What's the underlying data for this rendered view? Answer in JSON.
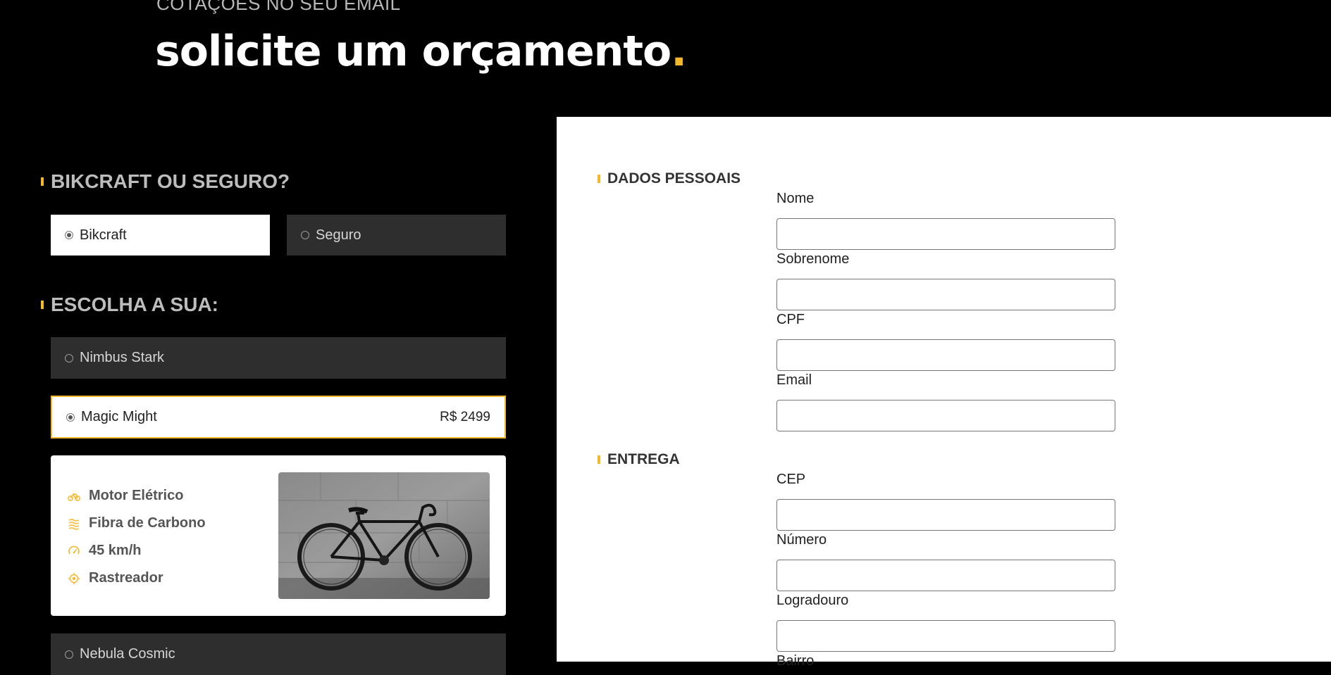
{
  "header": {
    "subtitle": "COTAÇÕES NO SEU EMAIL",
    "title": "solicite um orçamento",
    "title_dot": "."
  },
  "type_section": {
    "title": "BIKCRAFT OU SEGURO?",
    "options": [
      {
        "label": "Bikcraft",
        "selected": true
      },
      {
        "label": "Seguro",
        "selected": false
      }
    ]
  },
  "bike_section": {
    "title": "ESCOLHA A SUA:",
    "options": [
      {
        "label": "Nimbus Stark",
        "selected": false
      },
      {
        "label": "Magic Might",
        "price": "R$ 2499",
        "selected": true
      },
      {
        "label": "Nebula Cosmic",
        "selected": false
      }
    ],
    "features": [
      {
        "icon": "electric-bike-icon",
        "label": "Motor Elétrico"
      },
      {
        "icon": "carbon-fiber-icon",
        "label": "Fibra de Carbono"
      },
      {
        "icon": "speedometer-icon",
        "label": "45 km/h"
      },
      {
        "icon": "tracker-icon",
        "label": "Rastreador"
      }
    ]
  },
  "form": {
    "personal_title": "DADOS PESSOAIS",
    "personal_fields": [
      {
        "label": "Nome",
        "value": ""
      },
      {
        "label": "Sobrenome",
        "value": ""
      },
      {
        "label": "CPF",
        "value": ""
      },
      {
        "label": "Email",
        "value": ""
      }
    ],
    "delivery_title": "ENTREGA",
    "delivery_fields": [
      {
        "label": "CEP",
        "value": ""
      },
      {
        "label": "Número",
        "value": ""
      },
      {
        "label": "Logradouro",
        "value": ""
      },
      {
        "label": "Bairro",
        "value": ""
      }
    ]
  },
  "colors": {
    "accent": "#f4b82b",
    "page_background": "#000000",
    "dark_option": "#2e2e2e",
    "panel_background": "#ffffff"
  }
}
